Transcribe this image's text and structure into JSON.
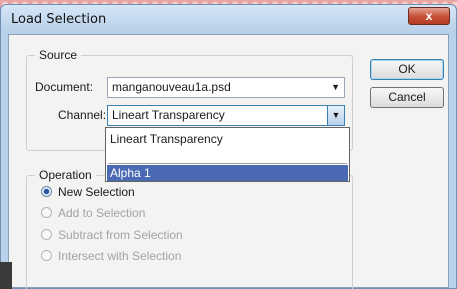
{
  "window": {
    "title": "Load Selection",
    "close_label": "x"
  },
  "source": {
    "group_label": "Source",
    "document_label": "Document:",
    "document_value": "manganouveau1a.psd",
    "channel_label": "Channel:",
    "channel_value": "Lineart Transparency",
    "dropdown_options": [
      "Lineart Transparency",
      "Alpha 1"
    ],
    "highlighted_option": "Alpha 1"
  },
  "operation": {
    "group_label": "Operation",
    "options": [
      {
        "label": "New Selection",
        "selected": true,
        "enabled": true
      },
      {
        "label": "Add to Selection",
        "selected": false,
        "enabled": false
      },
      {
        "label": "Subtract from Selection",
        "selected": false,
        "enabled": false
      },
      {
        "label": "Intersect with Selection",
        "selected": false,
        "enabled": false
      }
    ]
  },
  "buttons": {
    "ok_label": "OK",
    "cancel_label": "Cancel"
  },
  "icons": {
    "close": "close-icon",
    "dropdown_arrow": "chevron-down-icon",
    "radio": "radio-icon"
  }
}
